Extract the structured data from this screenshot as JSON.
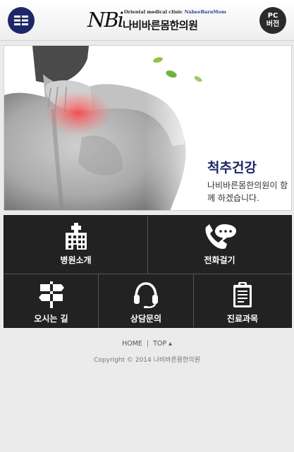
{
  "header": {
    "logo_mark": "NBi",
    "logo_subtitle_prefix": "Oriental medical clinic ",
    "logo_subtitle_brand": "NabeeBarnMom",
    "logo_korean": "나비바른몸한의원",
    "pc_line1": "PC",
    "pc_line2": "버전",
    "menu_icon": "hamburger-menu-icon"
  },
  "banner": {
    "title": "척추건강",
    "description": "나비바른몸한의원이 함께 하겠습니다.",
    "image_subject": "shoulder-pain-photo"
  },
  "menu": {
    "items": [
      {
        "label": "병원소개",
        "icon": "hospital-icon"
      },
      {
        "label": "전화걸기",
        "icon": "phone-chat-icon"
      },
      {
        "label": "오시는 길",
        "icon": "signpost-icon"
      },
      {
        "label": "상담문의",
        "icon": "headset-icon"
      },
      {
        "label": "진료과목",
        "icon": "clipboard-icon"
      }
    ]
  },
  "footer": {
    "home_label": "HOME",
    "separator": "|",
    "top_label": "TOP ▴",
    "copyright": "Copyright © 2014 나비바른몸한의원"
  },
  "colors": {
    "brand_navy": "#1d2767",
    "tile_background": "#222222",
    "page_background": "#ebebeb"
  }
}
